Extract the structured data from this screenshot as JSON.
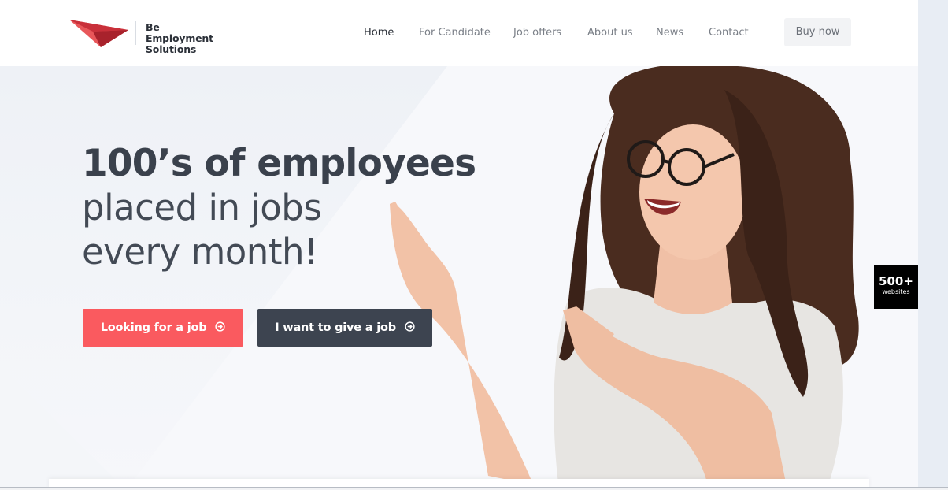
{
  "brand": {
    "name_line1": "Be Employment",
    "name_line2": "Solutions",
    "logo_icon": "paper-plane-logo-icon",
    "accent": "#d63a3f"
  },
  "nav": {
    "items": [
      {
        "label": "Home",
        "active": true
      },
      {
        "label": "For Candidate",
        "active": false
      },
      {
        "label": "Job offers",
        "active": false
      },
      {
        "label": "About us",
        "active": false
      },
      {
        "label": "News",
        "active": false
      },
      {
        "label": "Contact",
        "active": false
      }
    ],
    "buy_label": "Buy now"
  },
  "hero": {
    "headline_bold": "100’s of employees",
    "headline_line2": "placed in jobs",
    "headline_line3": "every month!",
    "primary_button": "Looking for a job",
    "secondary_button": "I want to give a job",
    "button_icon": "arrow-circle-right-icon",
    "primary_color": "#fa5a5f",
    "secondary_color": "#3d4450"
  },
  "side_badge": {
    "count": "500+",
    "label": "websites"
  }
}
